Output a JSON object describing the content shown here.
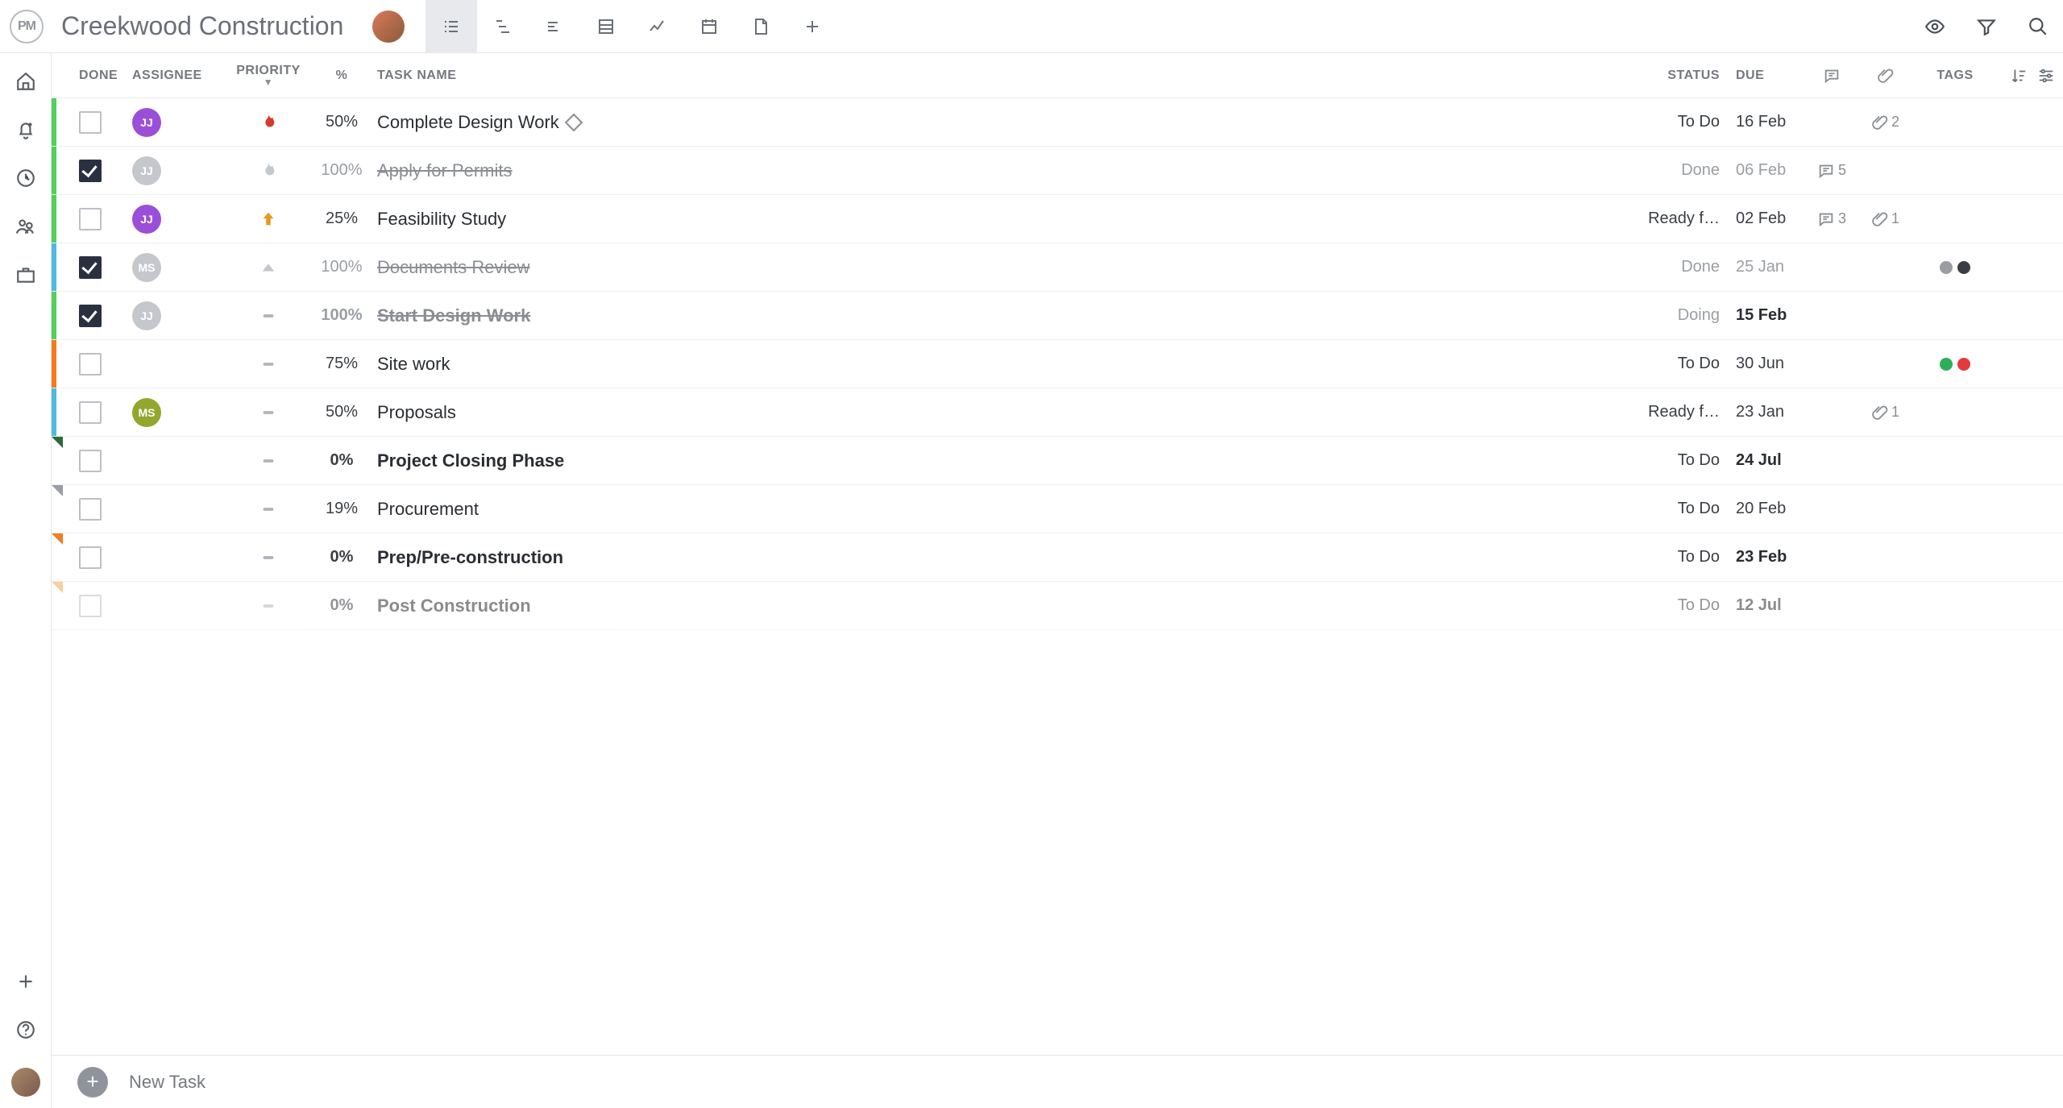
{
  "project_title": "Creekwood Construction",
  "columns": {
    "done": "DONE",
    "assignee": "ASSIGNEE",
    "priority": "PRIORITY",
    "percent": "%",
    "task_name": "TASK NAME",
    "status": "STATUS",
    "due": "DUE",
    "tags": "TAGS"
  },
  "footer": {
    "new_task": "New Task"
  },
  "icons": {
    "header_views": [
      "list",
      "gantt",
      "board",
      "table",
      "chart",
      "calendar",
      "file",
      "add"
    ],
    "header_right": [
      "eye",
      "filter",
      "search"
    ],
    "left_nav": [
      "home",
      "bell",
      "clock",
      "people",
      "briefcase"
    ],
    "left_nav_bottom": [
      "plus",
      "help"
    ]
  },
  "colors": {
    "bar_green": "#51d05b",
    "bar_blue": "#4fb9e3",
    "bar_orange": "#f47b20",
    "bar_darkgreen": "#2a6b3a",
    "bar_grey": "#9a9ea4",
    "bar_lightorange": "#f9a94a",
    "avatar_purple": "#9b4fd8",
    "avatar_grey": "#c4c8cc",
    "avatar_olive": "#93a72e",
    "priority_flame": "#d63a2a",
    "priority_flame_grey": "#b8bcc2",
    "priority_arrow": "#e69a1a",
    "priority_tri_grey": "#b8bcc2",
    "priority_dash": "#b0b4ba"
  },
  "tasks": [
    {
      "bar": "#51d05b",
      "done": false,
      "assignee": {
        "initials": "JJ",
        "color": "#9b4fd8"
      },
      "priority": "flame-red",
      "percent": "50%",
      "name": "Complete Design Work",
      "diamond": true,
      "bold": false,
      "strike": false,
      "status": "To Do",
      "due": "16 Feb",
      "due_bold": false,
      "comments": null,
      "attachments": 2,
      "tags": []
    },
    {
      "bar": "#51d05b",
      "done": true,
      "assignee": {
        "initials": "JJ",
        "color": "#c4c8cc"
      },
      "priority": "flame-grey",
      "percent": "100%",
      "name": "Apply for Permits",
      "diamond": false,
      "bold": false,
      "strike": true,
      "status": "Done",
      "due": "06 Feb",
      "due_bold": false,
      "comments": 5,
      "attachments": null,
      "tags": []
    },
    {
      "bar": "#51d05b",
      "done": false,
      "assignee": {
        "initials": "JJ",
        "color": "#9b4fd8"
      },
      "priority": "arrow-orange",
      "percent": "25%",
      "name": "Feasibility Study",
      "diamond": false,
      "bold": false,
      "strike": false,
      "status": "Ready f…",
      "due": "02 Feb",
      "due_bold": false,
      "comments": 3,
      "attachments": 1,
      "tags": []
    },
    {
      "bar": "#4fb9e3",
      "done": true,
      "assignee": {
        "initials": "MS",
        "color": "#c4c8cc"
      },
      "priority": "tri-grey",
      "percent": "100%",
      "name": "Documents Review",
      "diamond": false,
      "bold": false,
      "strike": true,
      "status": "Done",
      "due": "25 Jan",
      "due_bold": false,
      "comments": null,
      "attachments": null,
      "tags": [
        "#9a9ea4",
        "#3a3e44"
      ]
    },
    {
      "bar": "#51d05b",
      "done": true,
      "assignee": {
        "initials": "JJ",
        "color": "#c4c8cc"
      },
      "priority": "dash",
      "percent": "100%",
      "name": "Start Design Work",
      "diamond": false,
      "bold": true,
      "strike": true,
      "status": "Doing",
      "due": "15 Feb",
      "due_bold": true,
      "comments": null,
      "attachments": null,
      "tags": []
    },
    {
      "bar": "#f47b20",
      "done": false,
      "assignee": null,
      "priority": "dash",
      "percent": "75%",
      "name": "Site work",
      "diamond": false,
      "bold": false,
      "strike": false,
      "status": "To Do",
      "due": "30 Jun",
      "due_bold": false,
      "comments": null,
      "attachments": null,
      "tags": [
        "#2fae5a",
        "#e23b3b"
      ]
    },
    {
      "bar": "#4fb9e3",
      "done": false,
      "assignee": {
        "initials": "MS",
        "color": "#93a72e"
      },
      "priority": "dash",
      "percent": "50%",
      "name": "Proposals",
      "diamond": false,
      "bold": false,
      "strike": false,
      "status": "Ready f…",
      "due": "23 Jan",
      "due_bold": false,
      "comments": null,
      "attachments": 1,
      "tags": []
    },
    {
      "bar": "#2a6b3a",
      "fold": true,
      "done": false,
      "assignee": null,
      "priority": "dash",
      "percent": "0%",
      "name": "Project Closing Phase",
      "diamond": false,
      "bold": true,
      "strike": false,
      "status": "To Do",
      "due": "24 Jul",
      "due_bold": true,
      "comments": null,
      "attachments": null,
      "tags": []
    },
    {
      "bar": "#9a9ea4",
      "fold": true,
      "done": false,
      "assignee": null,
      "priority": "dash",
      "percent": "19%",
      "name": "Procurement",
      "diamond": false,
      "bold": false,
      "strike": false,
      "status": "To Do",
      "due": "20 Feb",
      "due_bold": false,
      "comments": null,
      "attachments": null,
      "tags": []
    },
    {
      "bar": "#f47b20",
      "fold": true,
      "done": false,
      "assignee": null,
      "priority": "dash",
      "percent": "0%",
      "name": "Prep/Pre-construction",
      "diamond": false,
      "bold": true,
      "strike": false,
      "status": "To Do",
      "due": "23 Feb",
      "due_bold": true,
      "comments": null,
      "attachments": null,
      "tags": []
    },
    {
      "bar": "#f9a94a",
      "fold": true,
      "done": false,
      "assignee": null,
      "priority": "dash",
      "percent": "0%",
      "name": "Post Construction",
      "diamond": false,
      "bold": true,
      "strike": false,
      "status": "To Do",
      "due": "12 Jul",
      "due_bold": true,
      "comments": null,
      "attachments": null,
      "tags": [],
      "faded": true
    }
  ]
}
